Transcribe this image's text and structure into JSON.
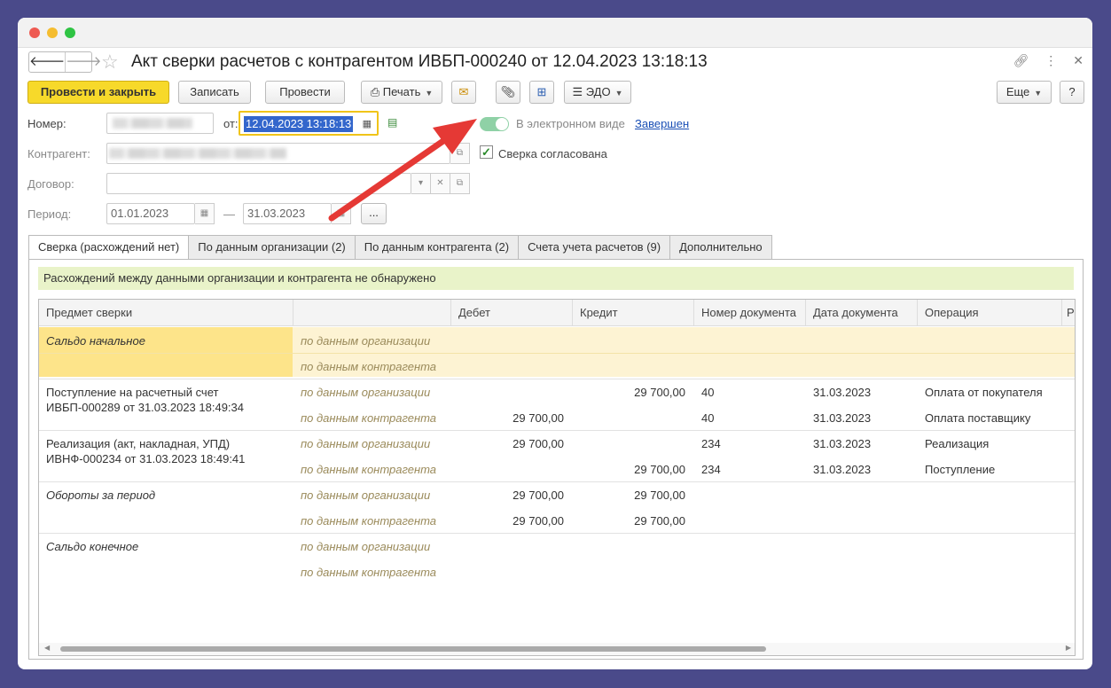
{
  "window": {
    "title": "Акт сверки расчетов с контрагентом ИВБП-000240 от 12.04.2023 13:18:13"
  },
  "nav": {
    "back": "🡐",
    "forward": "🡒"
  },
  "toolbar": {
    "post_close": "Провести и закрыть",
    "save": "Записать",
    "post": "Провести",
    "print": "Печать",
    "edo": "ЭДО",
    "more": "Еще",
    "help": "?"
  },
  "form": {
    "number_label": "Номер:",
    "date_prefix": "от:",
    "date_value": "12.04.2023 13:18:13",
    "electronic_label": "В электронном виде",
    "status_link": "Завершен",
    "counterparty_label": "Контрагент:",
    "agreed_label": "Сверка согласована",
    "contract_label": "Договор:",
    "period_label": "Период:",
    "period_from": "01.01.2023",
    "period_dash": "—",
    "period_to": "31.03.2023",
    "period_more": "..."
  },
  "tabs": [
    "Сверка (расхождений нет)",
    "По данным организации (2)",
    "По данным контрагента (2)",
    "Счета учета расчетов (9)",
    "Дополнительно"
  ],
  "notice": "Расхождений между данными организации и контрагента не обнаружено",
  "table": {
    "columns": [
      "Предмет сверки",
      "",
      "Дебет",
      "Кредит",
      "Номер документа",
      "Дата документа",
      "Операция",
      "Р"
    ],
    "source_org": "по данным организации",
    "source_cp": "по данным контрагента",
    "rows": [
      {
        "subject": "Сальдо начальное",
        "italic": true,
        "org": {
          "debit": "",
          "credit": "",
          "num": "",
          "date": "",
          "op": ""
        },
        "cp": {
          "debit": "",
          "credit": "",
          "num": "",
          "date": "",
          "op": ""
        }
      },
      {
        "subject": "Поступление на расчетный счет",
        "subject2": "ИВБП-000289 от 31.03.2023 18:49:34",
        "italic": false,
        "org": {
          "debit": "",
          "credit": "29 700,00",
          "num": "40",
          "date": "31.03.2023",
          "op": "Оплата от покупателя"
        },
        "cp": {
          "debit": "29 700,00",
          "credit": "",
          "num": "40",
          "date": "31.03.2023",
          "op": "Оплата поставщику"
        }
      },
      {
        "subject": "Реализация (акт, накладная, УПД)",
        "subject2": "ИВНФ-000234 от 31.03.2023 18:49:41",
        "italic": false,
        "org": {
          "debit": "29 700,00",
          "credit": "",
          "num": "234",
          "date": "31.03.2023",
          "op": "Реализация"
        },
        "cp": {
          "debit": "",
          "credit": "29 700,00",
          "num": "234",
          "date": "31.03.2023",
          "op": "Поступление"
        }
      },
      {
        "subject": "Обороты за период",
        "italic": true,
        "org": {
          "debit": "29 700,00",
          "credit": "29 700,00",
          "num": "",
          "date": "",
          "op": ""
        },
        "cp": {
          "debit": "29 700,00",
          "credit": "29 700,00",
          "num": "",
          "date": "",
          "op": ""
        }
      },
      {
        "subject": "Сальдо конечное",
        "italic": true,
        "org": {
          "debit": "",
          "credit": "",
          "num": "",
          "date": "",
          "op": ""
        },
        "cp": {
          "debit": "",
          "credit": "",
          "num": "",
          "date": "",
          "op": ""
        }
      }
    ]
  },
  "colors": {
    "primary_button": "#f7d92a",
    "link": "#1a4fb5",
    "arrow": "#e53935",
    "notice_bg": "#e9f3c9"
  }
}
